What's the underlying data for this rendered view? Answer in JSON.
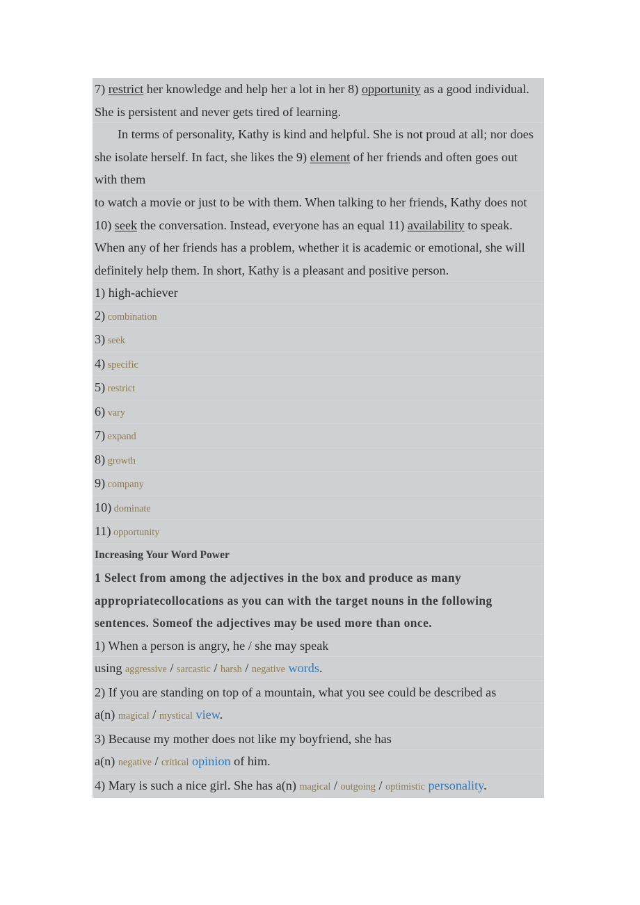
{
  "document": {
    "background_color": "#ffffff",
    "selection_color": "#cfd0d2",
    "body_text_color": "#2b2b2b",
    "answer_word_color": "#8d7a4f",
    "target_noun_color": "#2e79bd"
  },
  "paragraphs": {
    "p1_line1_a": "7) ",
    "p1_line1_gap1": "restrict",
    "p1_line1_b": " her knowledge and help her a lot in her 8) ",
    "p1_line1_gap2": "opportunity",
    "p1_line1_c": " as a good individual. She is persistent and never gets tired of learning.",
    "p2_a": "In terms of personality, Kathy is kind and helpful. She is not proud at all; nor does she isolate herself. In fact, she likes the 9) ",
    "p2_gap": "element",
    "p2_b": " of her friends and often goes out with them",
    "p3_a": "to watch a movie or just to be with them. When talking to her friends, Kathy does not 10) ",
    "p3_gap1": "seek",
    "p3_b": " the conversation. Instead, everyone has an equal 11) ",
    "p3_gap2": "availability",
    "p3_c": " to speak. When any of her friends has a problem, whether it is academic or emotional, she will definitely help them. In short, Kathy is a pleasant and positive person."
  },
  "answers": [
    {
      "number": "1)",
      "word": "high-achiever",
      "style": "plain"
    },
    {
      "number": "2)",
      "word": "combination",
      "style": "brown"
    },
    {
      "number": "3)",
      "word": "seek",
      "style": "brown"
    },
    {
      "number": "4)",
      "word": "specific",
      "style": "brown"
    },
    {
      "number": "5)",
      "word": "restrict",
      "style": "brown"
    },
    {
      "number": "6)",
      "word": "vary",
      "style": "brown"
    },
    {
      "number": "7)",
      "word": "expand",
      "style": "brown"
    },
    {
      "number": "8)",
      "word": "growth",
      "style": "brown"
    },
    {
      "number": "9)",
      "word": "company",
      "style": "brown"
    },
    {
      "number": "10)",
      "word": "dominate",
      "style": "brown"
    },
    {
      "number": "11)",
      "word": "opportunity",
      "style": "brown"
    }
  ],
  "section": {
    "heading": "Increasing Your Word Power",
    "instruction": "1 Select from among the adjectives in the box and produce as many appropriatecollocations as you can with the target nouns in the following sentences. Someof the adjectives may be used more than once."
  },
  "collocations": [
    {
      "lead": "1) When a person is angry, he / she may speak",
      "answer_prefix": "using ",
      "adjectives": [
        "aggressive",
        "sarcastic",
        "harsh",
        "negative"
      ],
      "noun": "words",
      "suffix": "."
    },
    {
      "lead": "2) If you are standing on top of a mountain, what you see could be described as",
      "answer_prefix": "a(n) ",
      "adjectives": [
        "magical",
        "mystical"
      ],
      "noun": "view",
      "suffix": "."
    },
    {
      "lead": "3) Because my mother does not like my boyfriend, she has",
      "answer_prefix": "a(n) ",
      "adjectives": [
        "negative",
        "critical"
      ],
      "noun": "opinion",
      "suffix": " of him."
    },
    {
      "lead": "",
      "answer_prefix": "4) Mary is such a nice girl. She has a(n) ",
      "adjectives": [
        "magical",
        "outgoing",
        "optimistic"
      ],
      "noun": "personality",
      "suffix": ".",
      "inline": true
    }
  ]
}
